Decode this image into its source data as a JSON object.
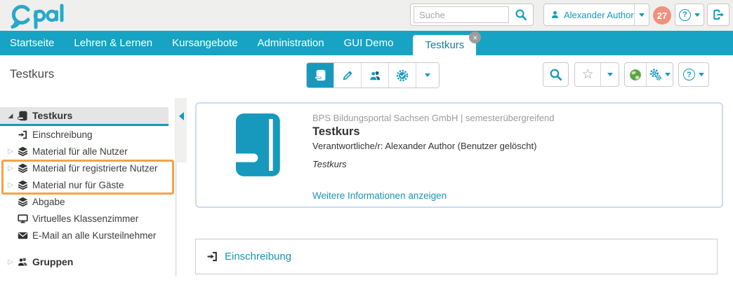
{
  "app": {
    "logo": "Opal"
  },
  "colors": {
    "primary_teal": "#1699bd",
    "nav_teal": "#17a3c4",
    "link_teal": "#1a93b4",
    "badge_salmon": "#ef917c",
    "highlight_orange": "#f2a24e",
    "card_border": "#cbdaeb"
  },
  "header": {
    "search_placeholder": "Suche",
    "user_name": "Alexander Author",
    "notification_count": "27",
    "icons": [
      "magnifier-icon",
      "person-icon",
      "question-icon",
      "exit-icon"
    ]
  },
  "nav": {
    "tabs": [
      "Startseite",
      "Lehren & Lernen",
      "Kursangebote",
      "Administration",
      "GUI Demo"
    ],
    "active_tab": "Testkurs",
    "close_glyph": "×"
  },
  "toolbar": {
    "page_title": "Testkurs",
    "view_icons": [
      "book-icon",
      "pencil-icon",
      "members-icon",
      "certificate-icon",
      "caret-down-icon"
    ],
    "right_icons": [
      "magnifier-icon",
      "star-icon",
      "globe-icon",
      "gears-icon",
      "question-icon"
    ],
    "star_glyph": "☆"
  },
  "sidebar": {
    "expanded_caret": "◢",
    "collapsed_caret": "▷",
    "items": [
      {
        "label": "Testkurs",
        "icon": "book-icon",
        "selected": true,
        "expanded": true
      },
      {
        "label": "Einschreibung",
        "icon": "enter-icon"
      },
      {
        "label": "Material für alle Nutzer",
        "icon": "layers-icon",
        "collapsible": true
      },
      {
        "label": "Material für registrierte Nutzer",
        "icon": "layers-icon",
        "collapsible": true,
        "highlighted": true
      },
      {
        "label": "Material nur für Gäste",
        "icon": "layers-icon",
        "collapsible": true,
        "highlighted": true
      },
      {
        "label": "Abgabe",
        "icon": "layers-icon"
      },
      {
        "label": "Virtuelles Klassenzimmer",
        "icon": "monitor-icon"
      },
      {
        "label": "E-Mail an alle Kursteilnehmer",
        "icon": "envelope-icon"
      },
      {
        "label": "Gruppen",
        "icon": "group-icon",
        "collapsible": true
      }
    ]
  },
  "main": {
    "course_card": {
      "meta": "BPS Bildungsportal Sachsen GmbH | semesterübergreifend",
      "title": "Testkurs",
      "responsible": "Verantwortliche/r: Alexander Author (Benutzer gelöscht)",
      "description": "Testkurs",
      "more_link": "Weitere Informationen anzeigen"
    },
    "enrollment_box": {
      "label": "Einschreibung",
      "icon": "enter-icon"
    }
  }
}
